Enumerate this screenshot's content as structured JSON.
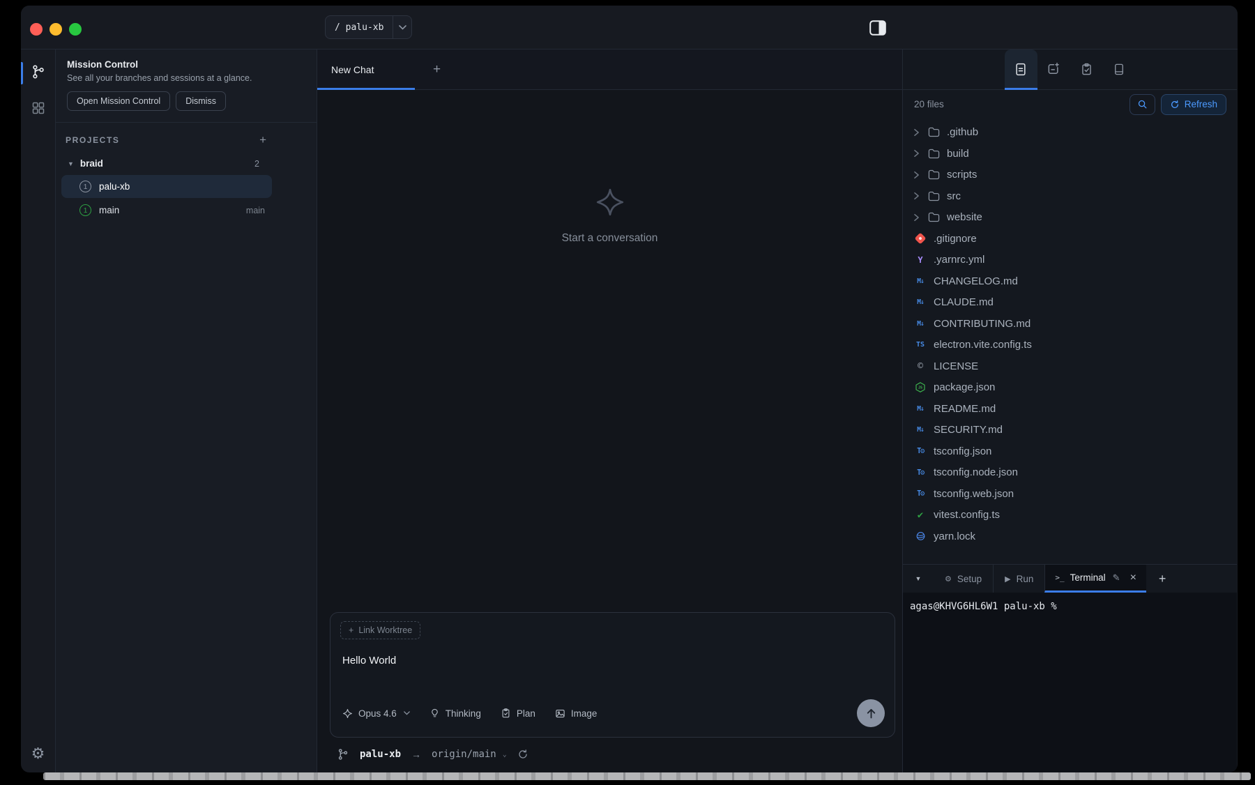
{
  "colors": {
    "accent_blue": "#3b7de8",
    "refresh_blue": "#4c9aff",
    "traffic_red": "#ff5f57",
    "traffic_yellow": "#febc2e",
    "traffic_green": "#28c840",
    "badge_green": "#2ea043",
    "selected_row": "#1f2a3a",
    "gitignore_red": "#f0544c",
    "markdown_blue": "#478be6",
    "yaml_purple": "#a78bfa",
    "node_green": "#3fb950",
    "vitest_green": "#2ea043",
    "yarn_blue": "#4f8ff7"
  },
  "titlebar": {
    "branch_pill": "/ palu-xb"
  },
  "sidebar": {
    "mission_control": {
      "title": "Mission Control",
      "description": "See all your branches and sessions at a glance.",
      "open_button": "Open Mission Control",
      "dismiss_button": "Dismiss"
    },
    "projects_header": "PROJECTS",
    "groups": [
      {
        "name": "braid",
        "count": "2",
        "items": [
          {
            "badge": "1",
            "badge_color": "gray",
            "name": "palu-xb",
            "meta": "",
            "selected": true
          },
          {
            "badge": "1",
            "badge_color": "green",
            "name": "main",
            "meta": "main",
            "selected": false
          }
        ]
      }
    ]
  },
  "chat": {
    "tab_label": "New Chat",
    "empty_state": "Start a conversation",
    "composer": {
      "link_worktree_label": "Link Worktree",
      "input_text": "Hello World",
      "model_label": "Opus 4.6",
      "thinking_label": "Thinking",
      "plan_label": "Plan",
      "image_label": "Image"
    },
    "status_bar": {
      "branch": "palu-xb",
      "remote": "origin/main"
    }
  },
  "files_panel": {
    "count_label": "20 files",
    "refresh_label": "Refresh",
    "tree": [
      {
        "name": ".github",
        "type": "folder"
      },
      {
        "name": "build",
        "type": "folder"
      },
      {
        "name": "scripts",
        "type": "folder"
      },
      {
        "name": "src",
        "type": "folder"
      },
      {
        "name": "website",
        "type": "folder"
      },
      {
        "name": ".gitignore",
        "type": "git"
      },
      {
        "name": ".yarnrc.yml",
        "type": "yaml"
      },
      {
        "name": "CHANGELOG.md",
        "type": "markdown"
      },
      {
        "name": "CLAUDE.md",
        "type": "markdown"
      },
      {
        "name": "CONTRIBUTING.md",
        "type": "markdown"
      },
      {
        "name": "electron.vite.config.ts",
        "type": "typescript"
      },
      {
        "name": "LICENSE",
        "type": "license"
      },
      {
        "name": "package.json",
        "type": "node"
      },
      {
        "name": "README.md",
        "type": "markdown"
      },
      {
        "name": "SECURITY.md",
        "type": "markdown"
      },
      {
        "name": "tsconfig.json",
        "type": "tsconfig"
      },
      {
        "name": "tsconfig.node.json",
        "type": "tsconfig"
      },
      {
        "name": "tsconfig.web.json",
        "type": "tsconfig"
      },
      {
        "name": "vitest.config.ts",
        "type": "vitest"
      },
      {
        "name": "yarn.lock",
        "type": "yarnlock"
      }
    ]
  },
  "terminal": {
    "tabs": [
      {
        "label": "Setup"
      },
      {
        "label": "Run"
      },
      {
        "label": "Terminal"
      }
    ],
    "prompt": "agas@KHVG6HL6W1 palu-xb %"
  }
}
